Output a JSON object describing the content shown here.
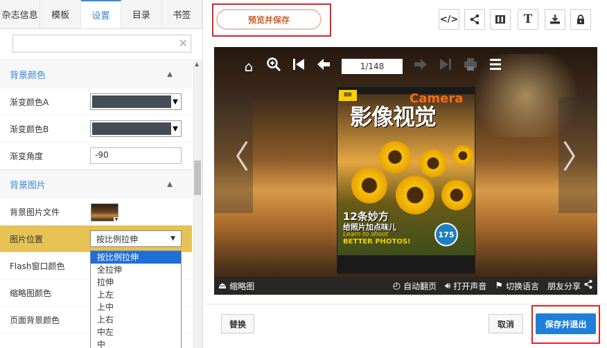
{
  "tabs": [
    {
      "label": "杂志信息",
      "active": false
    },
    {
      "label": "模板",
      "active": false
    },
    {
      "label": "设置",
      "active": true
    },
    {
      "label": "目录",
      "active": false
    },
    {
      "label": "书签",
      "active": false
    }
  ],
  "search": {
    "value": "",
    "placeholder": ""
  },
  "sections": {
    "bg_color": {
      "title": "背景颜色"
    },
    "bg_image": {
      "title": "背景图片"
    }
  },
  "props": {
    "gradient_a": {
      "label": "渐变颜色A",
      "color": "#444d55"
    },
    "gradient_b": {
      "label": "渐变颜色B",
      "color": "#444d55"
    },
    "gradient_angle": {
      "label": "渐变角度",
      "value": "-90"
    },
    "bg_image_file": {
      "label": "背景图片文件"
    },
    "image_position": {
      "label": "图片位置",
      "value": "按比例拉伸"
    },
    "flash_color": {
      "label": "Flash窗口颜色"
    },
    "thumb_color": {
      "label": "缩略图颜色"
    },
    "page_bg_color": {
      "label": "页面背景颜色"
    }
  },
  "dropdown_options": [
    "按比例拉伸",
    "全拉伸",
    "拉伸",
    "上左",
    "上中",
    "上右",
    "中左",
    "中"
  ],
  "dropdown_selected_index": 0,
  "toolbar": {
    "preview_save": "预览并保存",
    "icons": [
      "code-icon",
      "share-icon",
      "columns-icon",
      "text-icon",
      "download-icon",
      "lock-icon"
    ]
  },
  "viewer": {
    "page_indicator": "1/148",
    "magazine": {
      "badge": "摄影",
      "brand": "Camera",
      "title": "影像视觉",
      "headline1": "12条妙方",
      "headline2": "给照片加点味儿",
      "headline3": "Learn to shoot",
      "headline4": "BETTER PHOTOS!",
      "badge_number": "175"
    },
    "bottom": {
      "thumbnails": "缩略图",
      "auto_flip": "自动翻页",
      "sound": "打开声音",
      "language": "切换语言",
      "share": "朋友分享"
    }
  },
  "buttons": {
    "replace": "替换",
    "cancel": "取消",
    "save_exit": "保存并退出"
  },
  "colors": {
    "accent": "#3a8ad6",
    "highlight_row": "#e6c255",
    "primary_button": "#1f7fd8",
    "annotation_red": "#d9252a"
  }
}
